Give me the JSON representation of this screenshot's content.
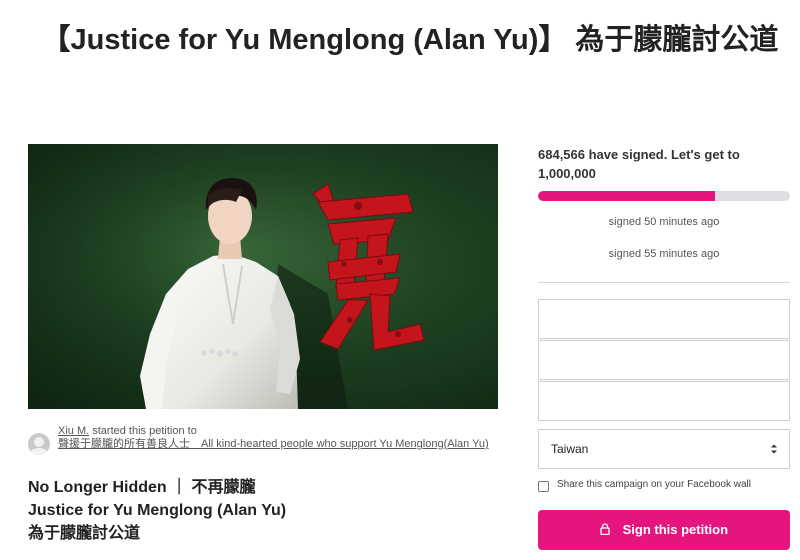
{
  "title": "【Justice for Yu Menglong (Alan Yu)】 為于朦朧討公道",
  "hero": {
    "image_desc": "man-in-white-suit-with-red-calligraphy",
    "calligraphy": "冤",
    "colors": {
      "background": "#1d4020",
      "calligraphy": "#c4151c"
    }
  },
  "starter": {
    "name": "Xiu M.",
    "action": "started this petition to",
    "target": "聲援于朦朧的所有善良人士　All kind-hearted people who support Yu Menglong(Alan Yu)"
  },
  "subtitle": {
    "line1": "No Longer Hidden ｜ 不再朦朧",
    "line2": "Justice for Yu Menglong (Alan Yu)",
    "line3": "為于朦朧討公道"
  },
  "signatures": {
    "count_text": "684,566 have signed. Let's get to 1,000,000",
    "signed": 684566,
    "goal": 1000000,
    "progress_fraction": 0.703
  },
  "recent": [
    "signed 50 minutes ago",
    "signed 55 minutes ago"
  ],
  "form": {
    "fields": [
      {
        "value": "",
        "placeholder": ""
      },
      {
        "value": "",
        "placeholder": ""
      },
      {
        "value": "",
        "placeholder": ""
      }
    ],
    "country": "Taiwan",
    "facebook_share_label": "Share this campaign on your Facebook wall",
    "facebook_share_checked": false,
    "sign_button_label": "Sign this petition"
  },
  "colors": {
    "accent": "#e4157f",
    "progress_track": "#dddde3"
  },
  "icons": {
    "lock": "lock-icon",
    "chevron": "select-chevron-icon",
    "avatar": "avatar"
  }
}
